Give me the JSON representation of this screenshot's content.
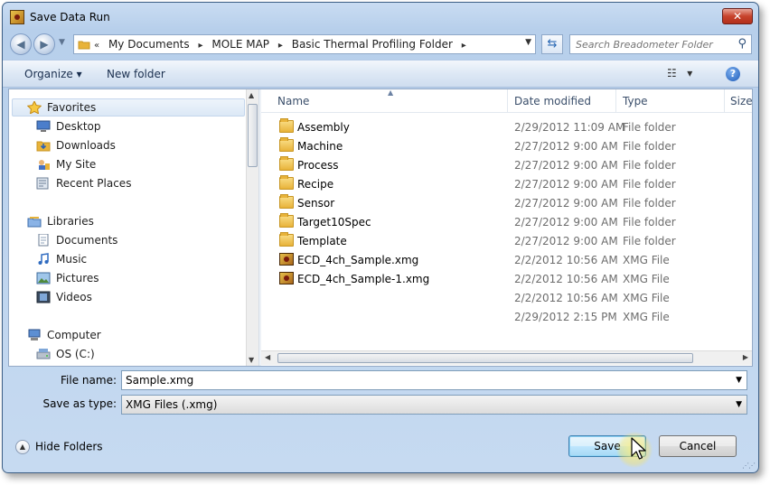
{
  "window": {
    "title": "Save Data Run",
    "close_label": "✕"
  },
  "address": {
    "crumbs": [
      "My Documents",
      "MOLE MAP",
      "Basic Thermal Profiling Folder"
    ],
    "search_placeholder": "Search Breadometer Folder"
  },
  "toolbar": {
    "organize": "Organize ▾",
    "new_folder": "New folder",
    "help": "?"
  },
  "sidebar": {
    "favorites": "Favorites",
    "desktop": "Desktop",
    "downloads": "Downloads",
    "my_site": "My Site",
    "recent_places": "Recent Places",
    "libraries": "Libraries",
    "documents": "Documents",
    "music": "Music",
    "pictures": "Pictures",
    "videos": "Videos",
    "computer": "Computer",
    "os_c": "OS (C:)"
  },
  "columns": {
    "name": "Name",
    "date": "Date modified",
    "type": "Type",
    "size": "Size"
  },
  "files": [
    {
      "name": "Assembly",
      "date": "2/29/2012 11:09 AM",
      "type": "File folder",
      "icon": "folder-icon"
    },
    {
      "name": "Machine",
      "date": "2/27/2012 9:00 AM",
      "type": "File folder",
      "icon": "folder-icon"
    },
    {
      "name": "Process",
      "date": "2/27/2012 9:00 AM",
      "type": "File folder",
      "icon": "folder-icon"
    },
    {
      "name": "Recipe",
      "date": "2/27/2012 9:00 AM",
      "type": "File folder",
      "icon": "folder-icon"
    },
    {
      "name": "Sensor",
      "date": "2/27/2012 9:00 AM",
      "type": "File folder",
      "icon": "folder-icon"
    },
    {
      "name": "Target10Spec",
      "date": "2/27/2012 9:00 AM",
      "type": "File folder",
      "icon": "folder-icon"
    },
    {
      "name": "Template",
      "date": "2/27/2012 9:00 AM",
      "type": "File folder",
      "icon": "folder-icon"
    },
    {
      "name": "ECD_4ch_Sample.xmg",
      "date": "2/2/2012 10:56 AM",
      "type": "XMG File",
      "icon": "xmg-file-icon"
    },
    {
      "name": "ECD_4ch_Sample-1.xmg",
      "date": "2/2/2012 10:56 AM",
      "type": "XMG File",
      "icon": "xmg-file-icon"
    },
    {
      "name": "",
      "date": "2/2/2012 10:56 AM",
      "type": "XMG File",
      "icon": ""
    },
    {
      "name": "",
      "date": "2/29/2012 2:15 PM",
      "type": "XMG File",
      "icon": ""
    }
  ],
  "form": {
    "file_name_label": "File name:",
    "file_name_value": "Sample.xmg",
    "save_type_label": "Save as type:",
    "save_type_value": "XMG Files (.xmg)"
  },
  "footer": {
    "hide_folders": "Hide Folders",
    "save": "Save",
    "cancel": "Cancel"
  }
}
